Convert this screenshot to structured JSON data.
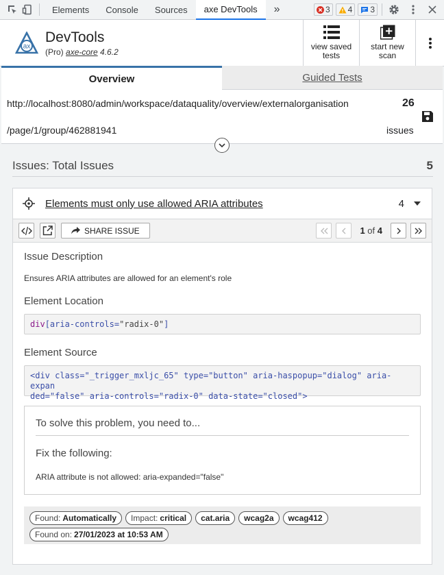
{
  "devtools_tabs": [
    "Elements",
    "Console",
    "Sources",
    "axe DevTools"
  ],
  "active_tab": "axe DevTools",
  "more_tabs": "»",
  "badges": {
    "errors": "3",
    "warnings": "4",
    "messages": "3"
  },
  "colors": {
    "accent": "#1a73e8",
    "error": "#d93025",
    "warning": "#f9ab00",
    "axe_blue": "#3872a8"
  },
  "header": {
    "title": "DevTools",
    "subtitle_prefix": "(Pro)",
    "subtitle_link": "axe-core",
    "version": "4.6.2",
    "view_saved_line1": "view saved",
    "view_saved_line2": "tests",
    "start_new_line1": "start new",
    "start_new_line2": "scan"
  },
  "tabs": {
    "overview": "Overview",
    "guided": "Guided Tests"
  },
  "scan": {
    "url_line1": "http://localhost:8080/admin/workspace/dataquality/overview/externalorganisation",
    "url_line2": "/page/1/group/462881941",
    "count": "26",
    "count_label": "issues"
  },
  "issues": {
    "title": "Issues: Total Issues",
    "total": "5"
  },
  "issue": {
    "title": "Elements must only use allowed ARIA attributes",
    "count": "4",
    "share_label": "SHARE ISSUE",
    "pager_current": "1",
    "pager_of": "of",
    "pager_total": "4",
    "description_heading": "Issue Description",
    "description": "Ensures ARIA attributes are allowed for an element's role",
    "location_heading": "Element Location",
    "location_selector": "div",
    "location_attr": "[aria-controls=",
    "location_value": "\"radix-0\"",
    "location_close": "]",
    "source_heading": "Element Source",
    "source_line1": "<div class=\"_trigger_mxljc_65\" type=\"button\" aria-haspopup=\"dialog\" aria-expan",
    "source_line2": "ded=\"false\" aria-controls=\"radix-0\" data-state=\"closed\">",
    "solve_heading": "To solve this problem, you need to...",
    "fix_heading": "Fix the following:",
    "fix_text": "ARIA attribute is not allowed: aria-expanded=\"false\"",
    "tags": [
      {
        "label": "Found:",
        "value": "Automatically"
      },
      {
        "label": "Impact:",
        "value": "critical"
      },
      {
        "label": "",
        "value": "cat.aria"
      },
      {
        "label": "",
        "value": "wcag2a"
      },
      {
        "label": "",
        "value": "wcag412"
      },
      {
        "label": "Found on:",
        "value": "27/01/2023 at 10:53 AM"
      }
    ]
  }
}
